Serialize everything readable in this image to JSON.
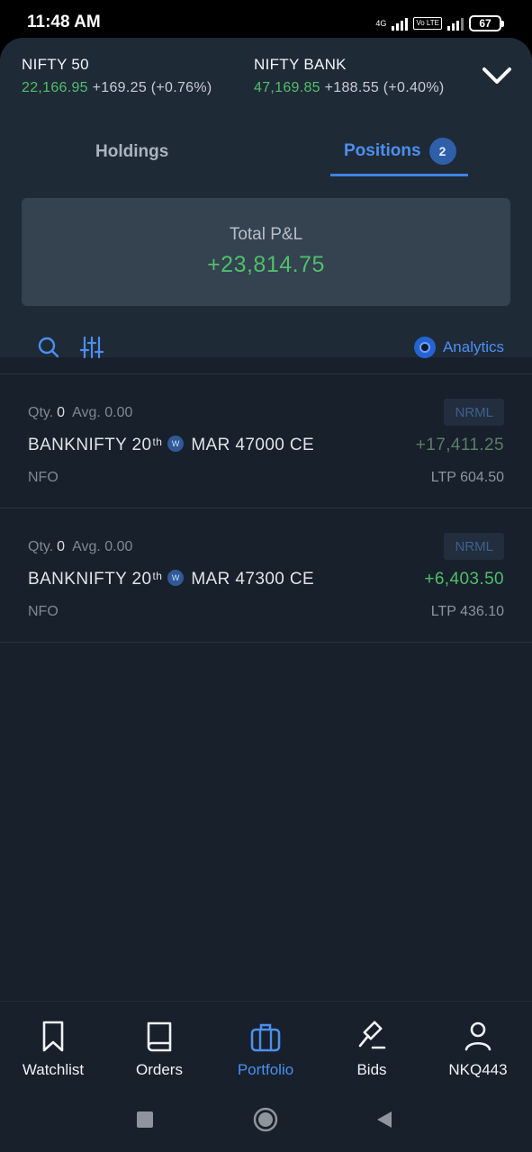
{
  "status": {
    "time": "11:48 AM",
    "network": "4G",
    "volte": "Vo LTE",
    "battery": "67"
  },
  "indices": [
    {
      "name": "NIFTY 50",
      "value": "22,166.95",
      "change": "+169.25 (+0.76%)"
    },
    {
      "name": "NIFTY BANK",
      "value": "47,169.85",
      "change": "+188.55 (+0.40%)"
    }
  ],
  "tabs": {
    "holdings": "Holdings",
    "positions": "Positions",
    "positions_count": "2"
  },
  "pnl": {
    "label": "Total P&L",
    "value": "+23,814.75"
  },
  "toolbar": {
    "analytics": "Analytics"
  },
  "positions": [
    {
      "qty_label": "Qty.",
      "qty": "0",
      "avg_label": "Avg.",
      "avg": "0.00",
      "product": "NRML",
      "symbol": "BANKNIFTY 20",
      "sup": "th",
      "weekly": "W",
      "contract": "MAR 47000 CE",
      "pnl": "+17,411.25",
      "exchange": "NFO",
      "ltp": "LTP 604.50"
    },
    {
      "qty_label": "Qty.",
      "qty": "0",
      "avg_label": "Avg.",
      "avg": "0.00",
      "product": "NRML",
      "symbol": "BANKNIFTY 20",
      "sup": "th",
      "weekly": "W",
      "contract": "MAR 47300 CE",
      "pnl": "+6,403.50",
      "exchange": "NFO",
      "ltp": "LTP 436.10"
    }
  ],
  "nav": {
    "watchlist": "Watchlist",
    "orders": "Orders",
    "portfolio": "Portfolio",
    "bids": "Bids",
    "profile": "NKQ443"
  },
  "colors": {
    "profit": "#4fbf6b",
    "accent": "#4c8ff0",
    "background": "#17202b",
    "panel": "#1f2a37"
  },
  "icons": [
    "chevron-down-icon",
    "search-icon",
    "filter-icon",
    "analytics-icon",
    "bookmark-icon",
    "book-icon",
    "briefcase-icon",
    "gavel-icon",
    "user-icon",
    "square-icon",
    "circle-icon",
    "back-icon"
  ]
}
